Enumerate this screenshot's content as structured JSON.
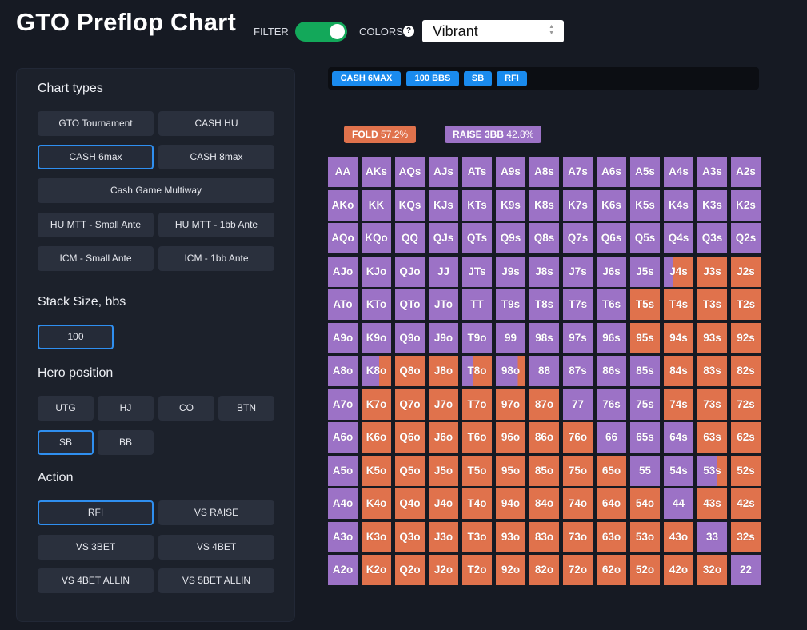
{
  "header": {
    "title": "GTO Preflop Chart",
    "filter_label": "FILTER",
    "colors_label": "COLORS",
    "help_glyph": "?",
    "colors_value": "Vibrant"
  },
  "sidebar": {
    "chart_types_title": "Chart types",
    "chart_types": [
      {
        "label": "GTO Tournament",
        "selected": false
      },
      {
        "label": "CASH HU",
        "selected": false
      },
      {
        "label": "CASH 6max",
        "selected": true
      },
      {
        "label": "CASH 8max",
        "selected": false
      },
      {
        "label": "Cash Game Multiway",
        "selected": false
      },
      {
        "label": "HU MTT - Small Ante",
        "selected": false
      },
      {
        "label": "HU MTT - 1bb Ante",
        "selected": false
      },
      {
        "label": "ICM - Small Ante",
        "selected": false
      },
      {
        "label": "ICM - 1bb Ante",
        "selected": false
      }
    ],
    "stack_title": "Stack Size, bbs",
    "stack_value": "100",
    "position_title": "Hero position",
    "positions": [
      {
        "label": "UTG",
        "selected": false
      },
      {
        "label": "HJ",
        "selected": false
      },
      {
        "label": "CO",
        "selected": false
      },
      {
        "label": "BTN",
        "selected": false
      },
      {
        "label": "SB",
        "selected": true
      },
      {
        "label": "BB",
        "selected": false
      }
    ],
    "action_title": "Action",
    "actions": [
      {
        "label": "RFI",
        "selected": true
      },
      {
        "label": "VS RAISE",
        "selected": false
      },
      {
        "label": "VS 3BET",
        "selected": false
      },
      {
        "label": "VS 4BET",
        "selected": false
      },
      {
        "label": "VS 4BET ALLIN",
        "selected": false
      },
      {
        "label": "VS 5BET ALLIN",
        "selected": false
      }
    ]
  },
  "tags": [
    "CASH 6MAX",
    "100 BBS",
    "SB",
    "RFI"
  ],
  "legend": {
    "fold_label": "FOLD",
    "fold_pct": "57.2%",
    "raise_label": "RAISE 3BB",
    "raise_pct": "42.8%"
  },
  "colors": {
    "fold": "#e0724c",
    "raise": "#9c72c6",
    "accent": "#1a8bee",
    "toggle_on": "#13a85a"
  },
  "matrix": {
    "ranks": [
      "A",
      "K",
      "Q",
      "J",
      "T",
      "9",
      "8",
      "7",
      "6",
      "5",
      "4",
      "3",
      "2"
    ],
    "raise_fraction": [
      [
        1,
        1,
        1,
        1,
        1,
        1,
        1,
        1,
        1,
        1,
        1,
        1,
        1
      ],
      [
        1,
        1,
        1,
        1,
        1,
        1,
        1,
        1,
        1,
        1,
        1,
        1,
        1
      ],
      [
        1,
        1,
        1,
        1,
        1,
        1,
        1,
        1,
        1,
        1,
        1,
        1,
        1
      ],
      [
        1,
        1,
        1,
        1,
        1,
        1,
        1,
        1,
        1,
        1,
        0.3,
        0,
        0
      ],
      [
        1,
        1,
        1,
        1,
        1,
        1,
        1,
        1,
        1,
        0,
        0,
        0,
        0
      ],
      [
        1,
        1,
        1,
        1,
        1,
        1,
        1,
        1,
        1,
        0,
        0,
        0,
        0
      ],
      [
        1,
        0.6,
        0,
        0,
        0.35,
        0.75,
        1,
        1,
        1,
        1,
        0,
        0,
        0
      ],
      [
        1,
        0,
        0,
        0,
        0,
        0,
        0,
        1,
        1,
        1,
        0,
        0,
        0
      ],
      [
        1,
        0,
        0,
        0,
        0,
        0,
        0,
        0,
        1,
        1,
        1,
        0,
        0
      ],
      [
        1,
        0,
        0,
        0,
        0,
        0,
        0,
        0,
        0,
        1,
        1,
        0.65,
        0
      ],
      [
        1,
        0,
        0,
        0,
        0,
        0,
        0,
        0,
        0,
        0,
        1,
        0,
        0
      ],
      [
        1,
        0,
        0,
        0,
        0,
        0,
        0,
        0,
        0,
        0,
        0,
        1,
        0
      ],
      [
        1,
        0,
        0,
        0,
        0,
        0,
        0,
        0,
        0,
        0,
        0,
        0,
        1
      ]
    ]
  }
}
